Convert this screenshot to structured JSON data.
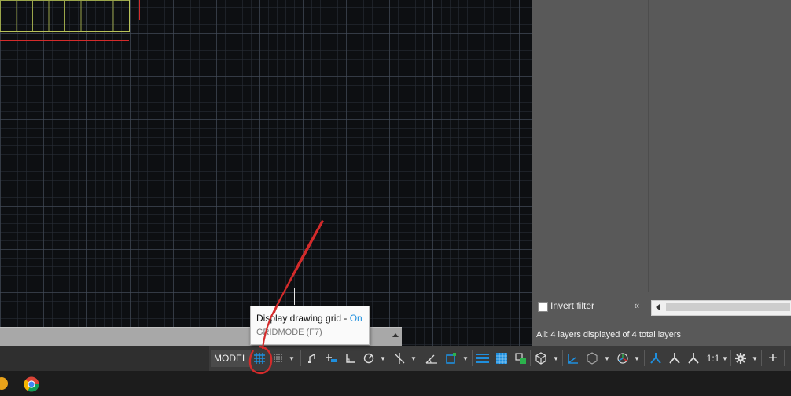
{
  "layer_panel": {
    "invert_filter_label": "Invert filter",
    "collapse_glyph": "«",
    "status_text": "All: 4 layers displayed of 4 total layers"
  },
  "statusbar": {
    "model_label": "MODEL",
    "annotation_scale": "1:1",
    "buttons": [
      {
        "name": "grid-display-icon",
        "state": "on"
      },
      {
        "name": "snap-mode-icon"
      },
      {
        "name": "infer-constraints-icon"
      },
      {
        "name": "ortho-mode-icon"
      },
      {
        "name": "polar-tracking-icon"
      },
      {
        "name": "isometric-drafting-icon"
      },
      {
        "name": "object-snap-tracking-icon"
      },
      {
        "name": "object-snap-icon"
      },
      {
        "name": "lineweight-icon"
      },
      {
        "name": "transparency-icon"
      },
      {
        "name": "selection-cycling-icon"
      },
      {
        "name": "3d-object-snap-icon"
      },
      {
        "name": "dynamic-ucs-icon"
      },
      {
        "name": "selection-filter-icon"
      },
      {
        "name": "gizmo-icon"
      },
      {
        "name": "annotation-visibility-icon"
      },
      {
        "name": "auto-scale-icon"
      },
      {
        "name": "annotation-scale-icon"
      },
      {
        "name": "workspace-gear-icon"
      },
      {
        "name": "customization-plus-icon"
      }
    ]
  },
  "tooltip": {
    "title": "Display drawing grid - ",
    "state": "On",
    "command": "GRIDMODE (F7)"
  },
  "colors": {
    "grid_on_accent": "#1f8fde",
    "annotation_red": "#d42b2b",
    "sheet_lines": "#b9c35a"
  }
}
